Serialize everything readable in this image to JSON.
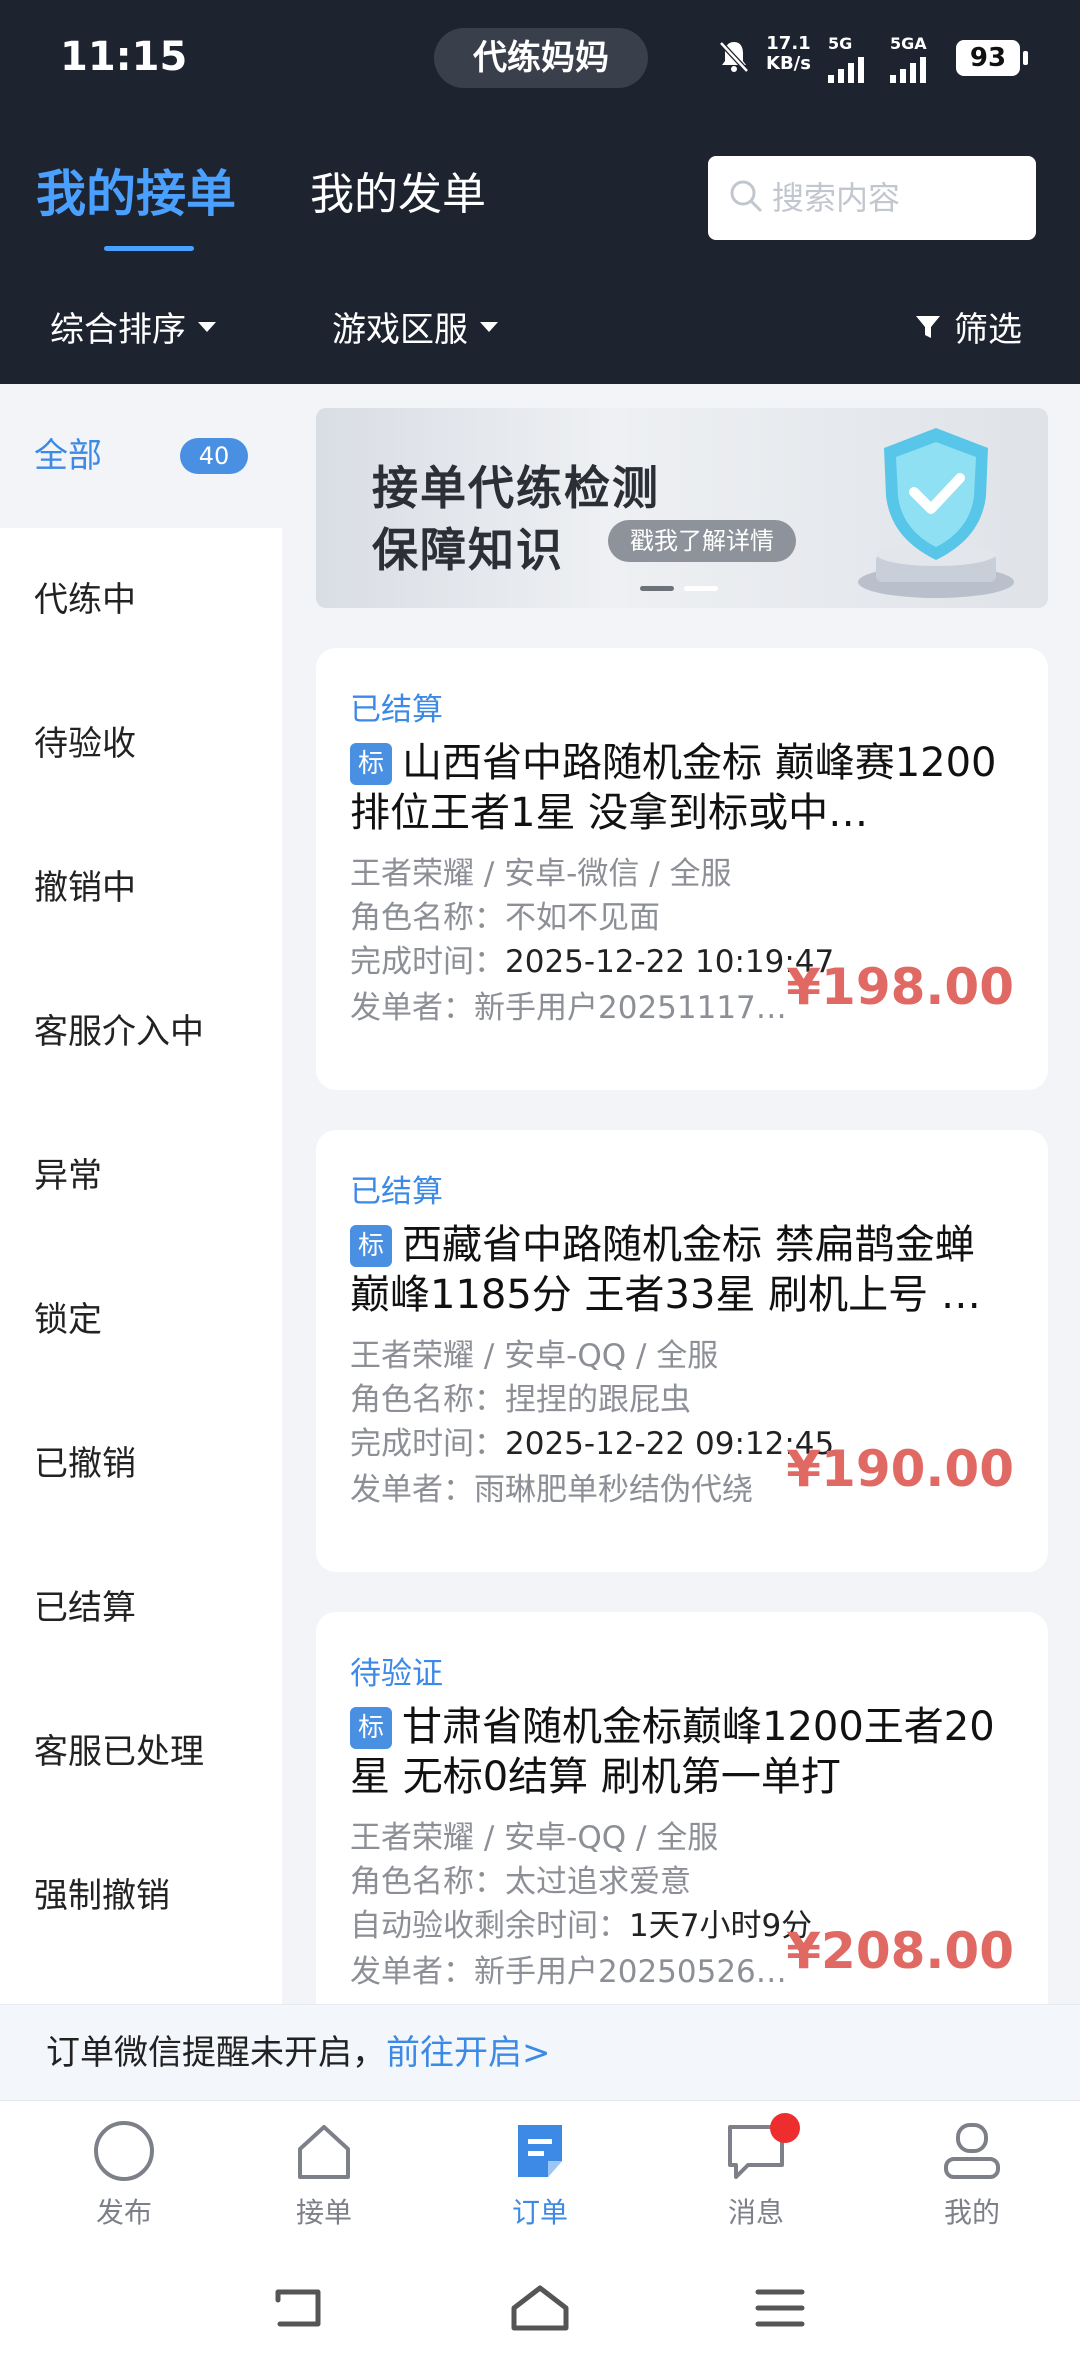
{
  "status_bar": {
    "time": "11:15",
    "app_pill": "代练妈妈",
    "speed_value": "17.1",
    "speed_unit": "KB/s",
    "net1": "5G",
    "net2": "5GA",
    "battery": "93"
  },
  "header": {
    "tab_active": "我的接单",
    "tab_other": "我的发单",
    "search_placeholder": "搜索内容",
    "sort_label": "综合排序",
    "server_label": "游戏区服",
    "filter_label": "筛选"
  },
  "sidebar": {
    "items": [
      {
        "label": "全部",
        "badge": "40"
      },
      {
        "label": "代练中"
      },
      {
        "label": "待验收"
      },
      {
        "label": "撤销中"
      },
      {
        "label": "客服介入中"
      },
      {
        "label": "异常"
      },
      {
        "label": "锁定"
      },
      {
        "label": "已撤销"
      },
      {
        "label": "已结算"
      },
      {
        "label": "客服已处理"
      },
      {
        "label": "强制撤销"
      }
    ]
  },
  "banner": {
    "line1": "接单代练检测",
    "line2": "保障知识",
    "cta": "戳我了解详情"
  },
  "orders": [
    {
      "status": "已结算",
      "tag": "标",
      "title": "山西省中路随机金标 巅峰赛1200 排位王者1星 没拿到标或中…",
      "game": "王者荣耀 / 安卓-微信 / 全服",
      "role_label": "角色名称：",
      "role": "不如不见面",
      "time_label": "完成时间：",
      "time": "2025-12-22 10:19:47",
      "publisher_label": "发单者：",
      "publisher": "新手用户202511175…",
      "price": "¥198.00"
    },
    {
      "status": "已结算",
      "tag": "标",
      "title": "西藏省中路随机金标 禁扁鹊金蝉 巅峰1185分 王者33星 刷机上号 …",
      "game": "王者荣耀 / 安卓-QQ / 全服",
      "role_label": "角色名称：",
      "role": "捏捏的跟屁虫",
      "time_label": "完成时间：",
      "time": "2025-12-22 09:12:45",
      "publisher_label": "发单者：",
      "publisher": "雨琳肥单秒结伪代绕",
      "price": "¥190.00"
    },
    {
      "status": "待验证",
      "tag": "标",
      "title": "甘肃省随机金标巅峰1200王者20星 无标0结算 刷机第一单打",
      "game": "王者荣耀 / 安卓-QQ / 全服",
      "role_label": "角色名称：",
      "role": "太过追求爱意",
      "time_label": "自动验收剩余时间：",
      "time": "1天7小时9分",
      "publisher_label": "发单者：",
      "publisher": "新手用户20250526…",
      "price": "¥208.00"
    }
  ],
  "notice": {
    "text": "订单微信提醒未开启，",
    "link": "前往开启>"
  },
  "bottom_nav": [
    {
      "label": "发布",
      "icon": "circle-icon"
    },
    {
      "label": "接单",
      "icon": "home-icon"
    },
    {
      "label": "订单",
      "icon": "order-icon"
    },
    {
      "label": "消息",
      "icon": "message-icon"
    },
    {
      "label": "我的",
      "icon": "profile-icon"
    }
  ],
  "colors": {
    "header_bg": "#1e2330",
    "accent": "#3d8ae6",
    "price": "#e06a63",
    "badge_red": "#ee2e2e"
  }
}
